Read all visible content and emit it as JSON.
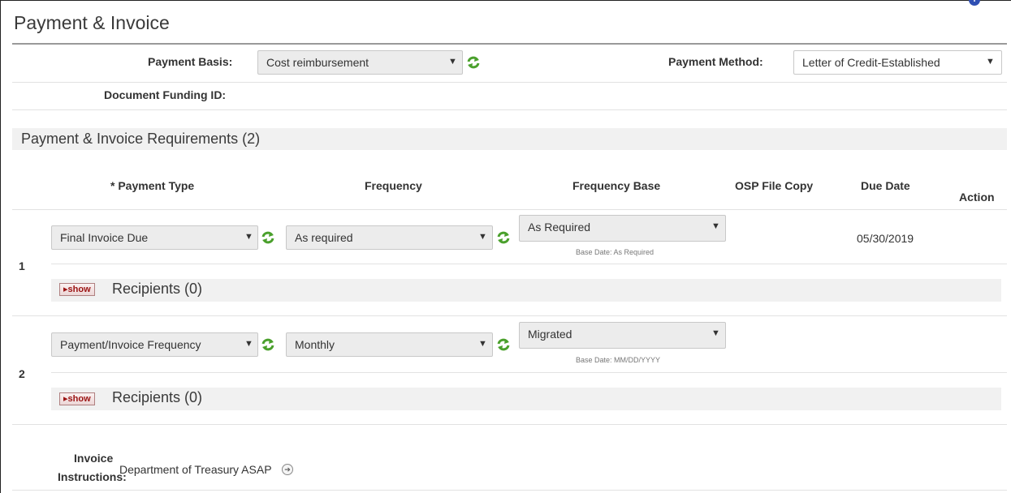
{
  "page": {
    "title": "Payment & Invoice"
  },
  "payment_basis": {
    "label": "Payment Basis:",
    "value": "Cost reimbursement"
  },
  "payment_method": {
    "label": "Payment Method:",
    "value": "Letter of Credit-Established"
  },
  "document_funding": {
    "label": "Document Funding ID:",
    "value": ""
  },
  "requirements": {
    "title": "Payment & Invoice Requirements (2)",
    "columns": {
      "payment_type": "* Payment Type",
      "frequency": "Frequency",
      "frequency_base": "Frequency Base",
      "osp_file_copy": "OSP File Copy",
      "due_date": "Due Date",
      "action": "Action"
    },
    "rows": [
      {
        "number": "1",
        "payment_type": "Final Invoice Due",
        "frequency": "As required",
        "frequency_base": "As Required",
        "base_date_note": "Base Date: As Required",
        "osp_file_copy": "",
        "due_date": "05/30/2019",
        "show_label": "show",
        "recipients": "Recipients (0)"
      },
      {
        "number": "2",
        "payment_type": "Payment/Invoice Frequency",
        "frequency": "Monthly",
        "frequency_base": "Migrated",
        "base_date_note": "Base Date: MM/DD/YYYY",
        "osp_file_copy": "",
        "due_date": "",
        "show_label": "show",
        "recipients": "Recipients (0)"
      }
    ]
  },
  "invoice_instructions": {
    "label_line1": "Invoice",
    "label_line2": "Instructions:",
    "value": "Department of Treasury ASAP"
  },
  "icons": {
    "refresh": "refresh-icon",
    "caret": "chevron-down-icon",
    "go": "arrow-right-circle-icon",
    "help": "info-icon",
    "show": "triangle-right-icon"
  },
  "colors": {
    "refresh_green": "#4aa02c",
    "show_red": "#9a1212",
    "help_blue": "#2f4fb3"
  }
}
